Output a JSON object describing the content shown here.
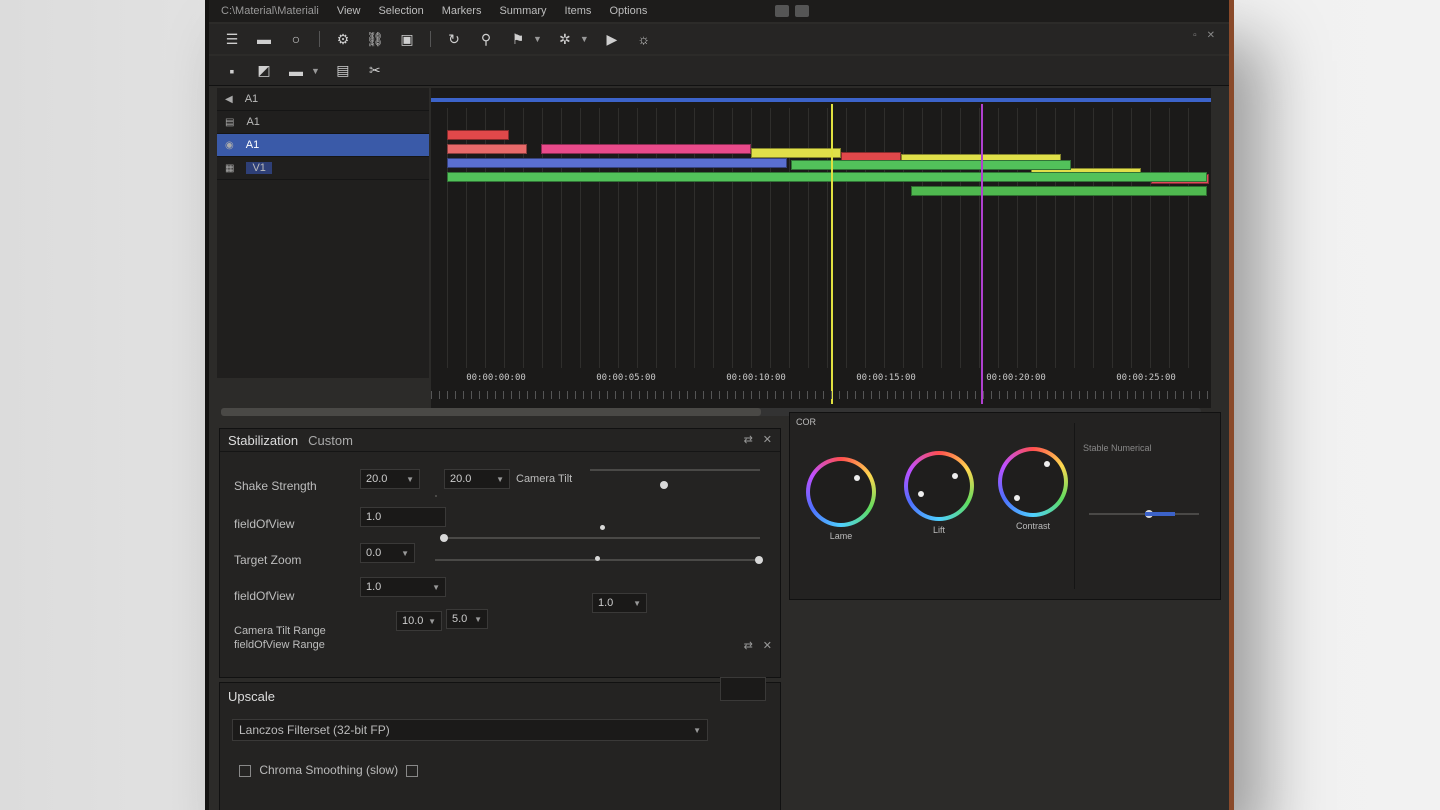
{
  "menubar": {
    "path": "C:\\Material\\Materiali",
    "items": [
      "View",
      "Selection",
      "Markers",
      "Summary",
      "Items",
      "Options"
    ]
  },
  "tracks": [
    {
      "label": "A1",
      "icon": "speaker-icon"
    },
    {
      "label": "A1",
      "icon": "lock-icon"
    },
    {
      "label": "A1",
      "icon": "eye-icon",
      "selected": true
    },
    {
      "label": "V1",
      "icon": "film-icon",
      "selected2": true
    }
  ],
  "timeline": {
    "timecodes": [
      "00:00:00:00",
      "00:00:05:00",
      "00:00:10:00",
      "00:00:15:00",
      "00:00:20:00",
      "00:00:25:00"
    ],
    "playhead_color": "#e0e040",
    "marker_color": "#b040d0"
  },
  "stabilization": {
    "title": "Stabilization",
    "tab2": "Custom",
    "shake_label": "Shake Strength",
    "shake_value": "20.0",
    "shake_value2": "20.0",
    "camera_tilt_label": "Camera Tilt",
    "fov_label": "fieldOfView",
    "fov_value": "1.0",
    "zoom_label": "Target Zoom",
    "zoom_value": "0.0",
    "fov2_label": "fieldOfView",
    "fov2_value": "1.0",
    "tilt_range_label": "Camera Tilt Range",
    "fov_range_label": "fieldOfView Range",
    "tilt_range_value": "10.0",
    "tilt_range_value2": "5.0",
    "extra_value": "1.0"
  },
  "upscale": {
    "title": "Upscale",
    "filter_value": "Lanczos Filterset (32-bit FP)",
    "chroma_label": "Chroma Smoothing (slow)"
  },
  "color": {
    "title": "COR",
    "wheels": [
      "Lame",
      "Lift",
      "Contrast"
    ],
    "side_label": "Stable Numerical"
  }
}
